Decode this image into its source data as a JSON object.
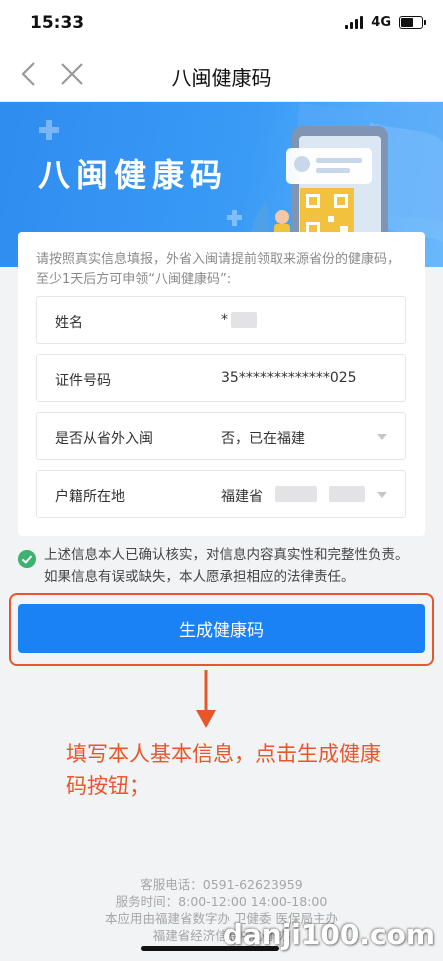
{
  "status_bar": {
    "time": "15:33",
    "network": "4G"
  },
  "nav": {
    "title": "八闽健康码"
  },
  "banner": {
    "title": "八闽健康码"
  },
  "notice": "请按照真实信息填报，外省入闽请提前领取来源省份的健康码，至少1天后方可申领“八闽健康码”:",
  "form": {
    "name": {
      "label": "姓名",
      "value": "*"
    },
    "id_number": {
      "label": "证件号码",
      "value": "35*************025"
    },
    "from_out_of_province": {
      "label": "是否从省外入闽",
      "value": "否，已在福建"
    },
    "household_location": {
      "label": "户籍所在地",
      "value": "福建省"
    }
  },
  "agreement": "上述信息本人已确认核实，对信息内容真实性和完整性负责。如果信息有误或缺失，本人愿承担相应的法律责任。",
  "primary_button": "生成健康码",
  "annotation": "填写本人基本信息，点击生成健康码按钮；",
  "footer": {
    "hotline": "客服电话：0591-62623959",
    "service_hours": "服务时间：8:00-12:00 14:00-18:00",
    "sponsors": "本应用由福建省数字办 卫健委 医保局主办",
    "operator": "福建省经济信息中心承办"
  },
  "watermark": "danji100.com",
  "colors": {
    "primary": "#1b82f5",
    "annotation": "#e8572a",
    "check": "#3cb371",
    "banner": "#2f8cf0"
  },
  "icons": [
    "back-chevron-icon",
    "close-icon",
    "check-circle-icon",
    "dropdown-caret-icon",
    "down-arrow-icon"
  ]
}
